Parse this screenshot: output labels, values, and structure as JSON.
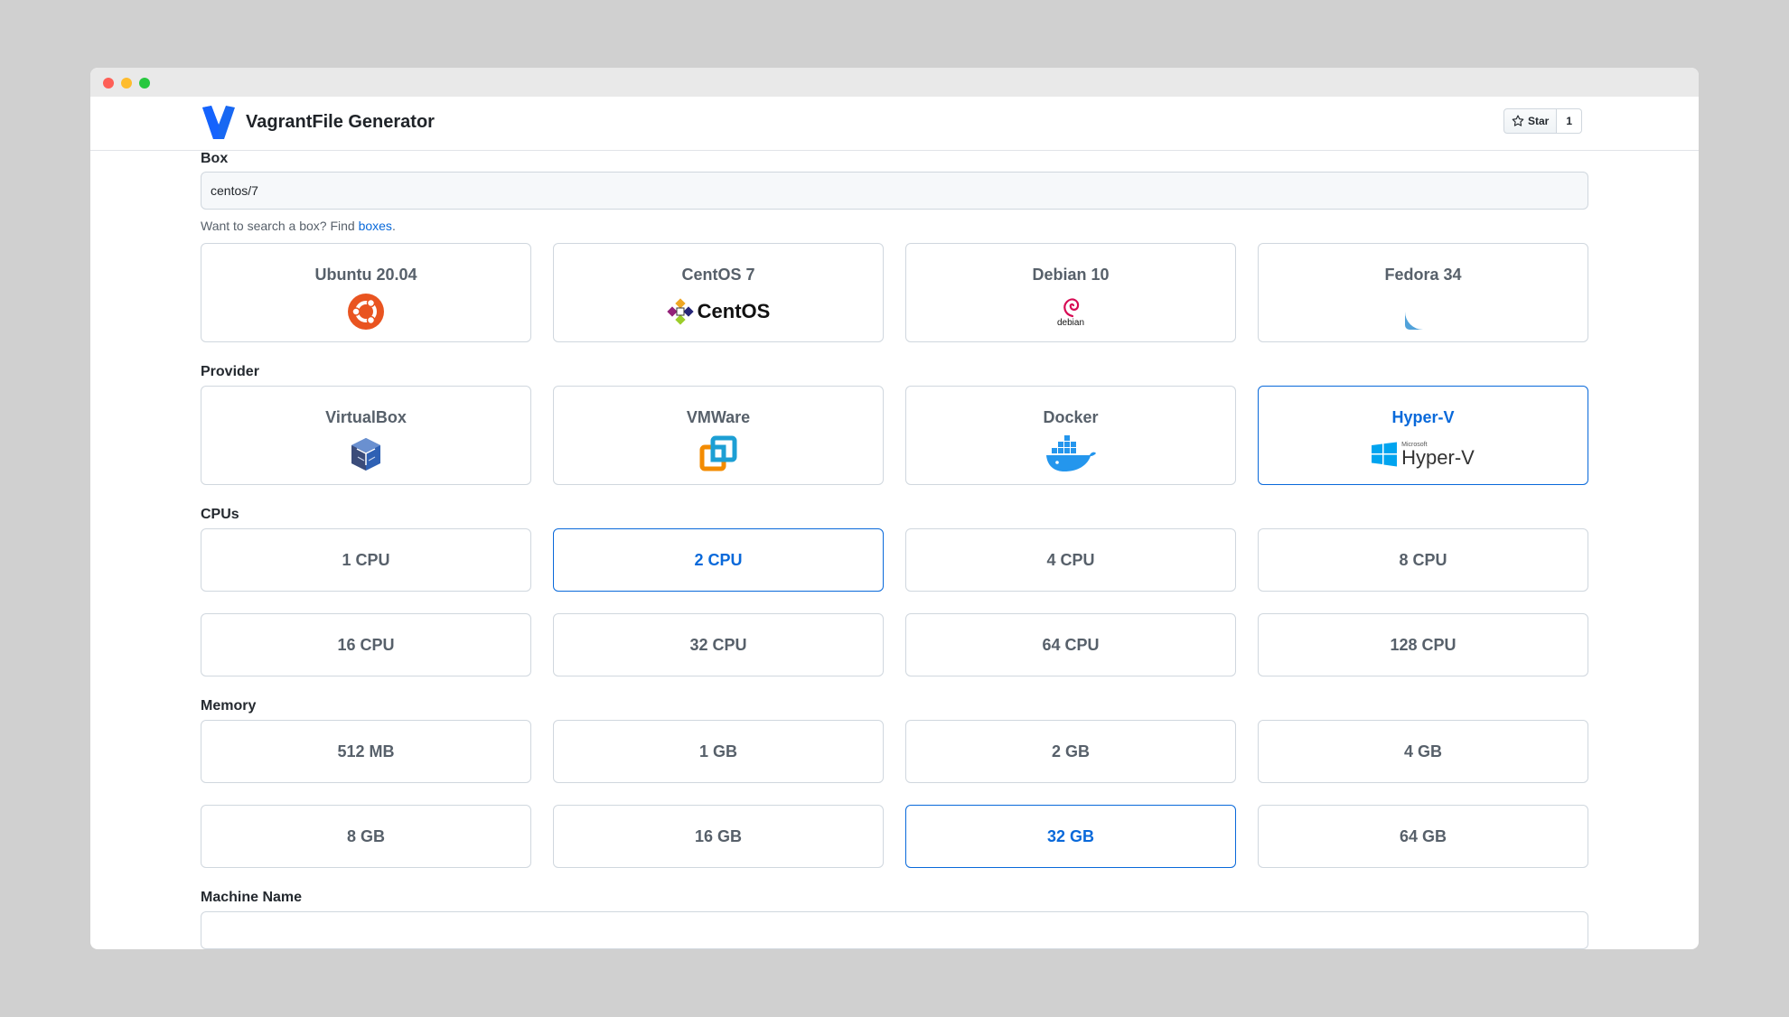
{
  "app": {
    "title": "VagrantFile Generator"
  },
  "github": {
    "star_label": "Star",
    "star_count": "1"
  },
  "box": {
    "label": "Box",
    "value": "centos/7",
    "hint_prefix": "Want to search a box? Find ",
    "hint_link": "boxes",
    "hint_suffix": ".",
    "options": [
      {
        "label": "Ubuntu 20.04",
        "icon": "ubuntu-logo-icon",
        "selected": false
      },
      {
        "label": "CentOS 7",
        "icon": "centos-logo-icon",
        "logo_text": "CentOS",
        "selected": true
      },
      {
        "label": "Debian 10",
        "icon": "debian-logo-icon",
        "logo_text": "debian",
        "selected": false
      },
      {
        "label": "Fedora 34",
        "icon": "fedora-logo-icon",
        "selected": false
      }
    ]
  },
  "provider": {
    "label": "Provider",
    "options": [
      {
        "label": "VirtualBox",
        "icon": "virtualbox-logo-icon",
        "selected": false
      },
      {
        "label": "VMWare",
        "icon": "vmware-logo-icon",
        "selected": false
      },
      {
        "label": "Docker",
        "icon": "docker-logo-icon",
        "selected": false
      },
      {
        "label": "Hyper-V",
        "icon": "hyperv-logo-icon",
        "logo_text": "Hyper-V",
        "logo_subtext": "Microsoft",
        "selected": true
      }
    ]
  },
  "cpus": {
    "label": "CPUs",
    "options": [
      {
        "label": "1 CPU",
        "selected": false
      },
      {
        "label": "2 CPU",
        "selected": true
      },
      {
        "label": "4 CPU",
        "selected": false
      },
      {
        "label": "8 CPU",
        "selected": false
      },
      {
        "label": "16 CPU",
        "selected": false
      },
      {
        "label": "32 CPU",
        "selected": false
      },
      {
        "label": "64 CPU",
        "selected": false
      },
      {
        "label": "128 CPU",
        "selected": false
      }
    ]
  },
  "memory": {
    "label": "Memory",
    "options": [
      {
        "label": "512 MB",
        "selected": false
      },
      {
        "label": "1 GB",
        "selected": false
      },
      {
        "label": "2 GB",
        "selected": false
      },
      {
        "label": "4 GB",
        "selected": false
      },
      {
        "label": "8 GB",
        "selected": false
      },
      {
        "label": "16 GB",
        "selected": false
      },
      {
        "label": "32 GB",
        "selected": true
      },
      {
        "label": "64 GB",
        "selected": false
      }
    ]
  },
  "machine_name": {
    "label": "Machine Name"
  },
  "colors": {
    "accent": "#0969da",
    "muted": "#57606a",
    "border": "#d0d7de"
  }
}
